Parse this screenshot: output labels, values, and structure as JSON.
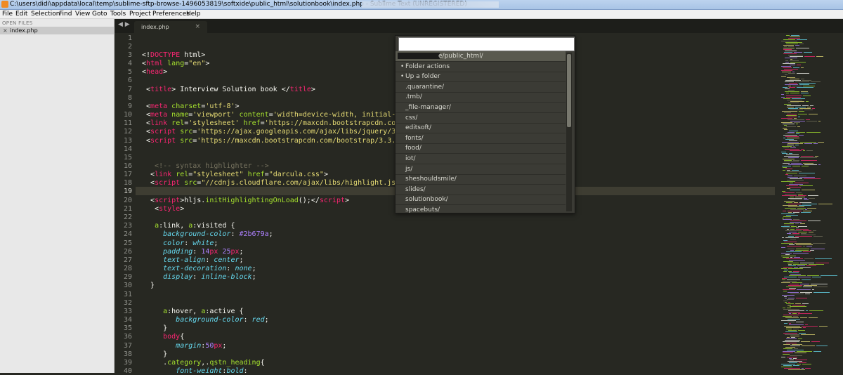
{
  "window": {
    "title": "C:\\users\\didi\\appdata\\local\\temp\\sublime-sftp-browse-1496053819\\softxide\\public_html\\solutionbook\\index.php - Sublime Text (UNREGISTERED)"
  },
  "menu": [
    "File",
    "Edit",
    "Selection",
    "Find",
    "View",
    "Goto",
    "Tools",
    "Project",
    "Preferences",
    "Help"
  ],
  "sidebar": {
    "header": "OPEN FILES",
    "files": [
      {
        "close": "×",
        "name": "index.php"
      }
    ]
  },
  "tabbar": {
    "nav": "◀ ▶",
    "tab": {
      "name": "index.php",
      "close": "×"
    }
  },
  "editor": {
    "line_numbers": [
      "1",
      "2",
      "3",
      "4",
      "5",
      "6",
      "7",
      "8",
      "9",
      "10",
      "11",
      "12",
      "13",
      "14",
      "15",
      "16",
      "17",
      "18",
      "19",
      "20",
      "21",
      "22",
      "23",
      "24",
      "25",
      "26",
      "27",
      "28",
      "29",
      "30",
      "31",
      "32",
      "33",
      "34",
      "35",
      "36",
      "37",
      "38",
      "39",
      "40"
    ],
    "highlight_line": 19
  },
  "quick_panel": {
    "input_value": "",
    "items": [
      {
        "text": "e/public_html/",
        "selected": true
      },
      {
        "text": "Folder actions",
        "action": true
      },
      {
        "text": "Up a folder",
        "action": true
      },
      {
        "text": ".quarantine/"
      },
      {
        "text": ".tmb/"
      },
      {
        "text": "_file-manager/"
      },
      {
        "text": "css/"
      },
      {
        "text": "editsoft/"
      },
      {
        "text": "fonts/"
      },
      {
        "text": "food/"
      },
      {
        "text": "iot/"
      },
      {
        "text": "js/"
      },
      {
        "text": "sheshouldsmile/"
      },
      {
        "text": "slides/"
      },
      {
        "text": "solutionbook/"
      },
      {
        "text": "spacebuts/"
      }
    ],
    "bullet": "•"
  },
  "colors": {
    "background": "#272822",
    "keyword": "#f92672",
    "attribute": "#a6e22e",
    "string": "#e6db74",
    "comment": "#75715e",
    "property": "#66d9ef",
    "number": "#ae81ff"
  }
}
